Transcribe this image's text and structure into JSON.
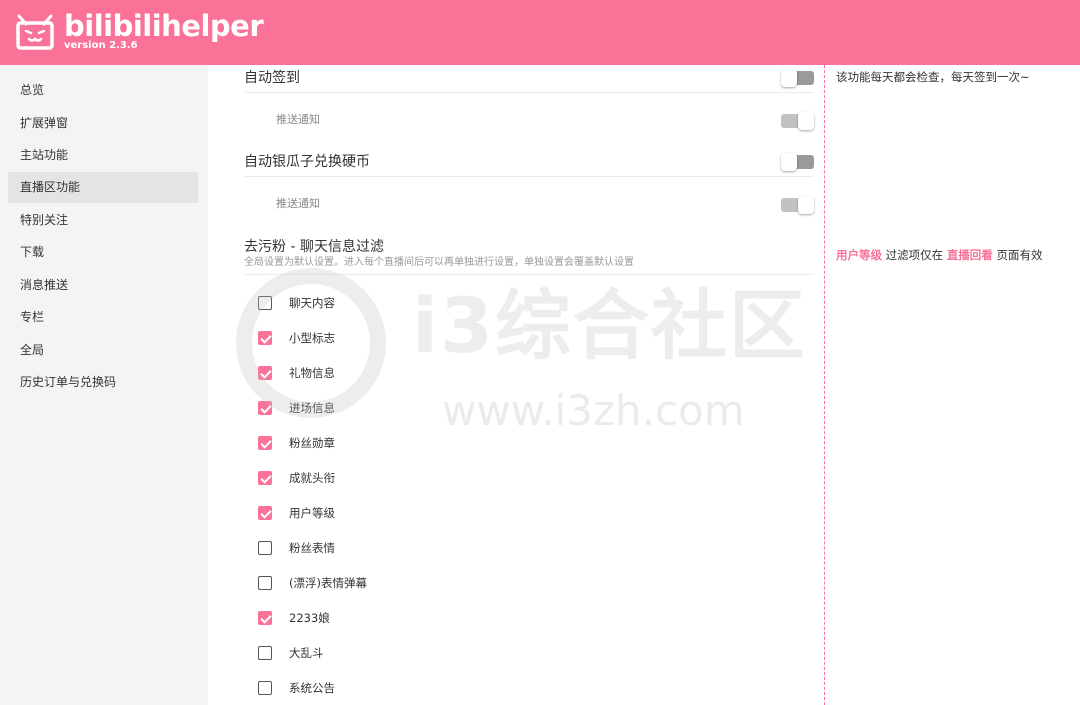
{
  "header": {
    "brand": "bilibilihelper",
    "version": "version 2.3.6",
    "logo_icon": "bilibili-tv-face-icon",
    "bg_color": "#fb7299"
  },
  "sidebar": {
    "items": [
      {
        "label": "总览"
      },
      {
        "label": "扩展弹窗"
      },
      {
        "label": "主站功能"
      },
      {
        "label": "直播区功能",
        "active": true
      },
      {
        "label": "特别关注"
      },
      {
        "label": "下载"
      },
      {
        "label": "消息推送"
      },
      {
        "label": "专栏"
      },
      {
        "label": "全局"
      },
      {
        "label": "历史订单与兑换码"
      }
    ]
  },
  "settings": {
    "auto_sign": {
      "title": "自动签到",
      "enabled": false,
      "push_label": "推送通知",
      "push_enabled": false,
      "desc": "该功能每天都会检查，每天签到一次~"
    },
    "silver_to_coin": {
      "title": "自动银瓜子兑换硬币",
      "enabled": false,
      "push_label": "推送通知",
      "push_enabled": false
    },
    "chat_filter": {
      "title": "去污粉 - 聊天信息过滤",
      "subtitle": "全局设置为默认设置。进入每个直播间后可以再单独进行设置，单独设置会覆盖默认设置",
      "desc_highlight_1": "用户等级",
      "desc_text_1": " 过滤项仅在 ",
      "desc_highlight_2": "直播回看",
      "desc_text_2": " 页面有效",
      "options": [
        {
          "label": "聊天内容",
          "checked": false
        },
        {
          "label": "小型标志",
          "checked": true
        },
        {
          "label": "礼物信息",
          "checked": true
        },
        {
          "label": "进场信息",
          "checked": true
        },
        {
          "label": "粉丝勋章",
          "checked": true
        },
        {
          "label": "成就头衔",
          "checked": true
        },
        {
          "label": "用户等级",
          "checked": true
        },
        {
          "label": "粉丝表情",
          "checked": false
        },
        {
          "label": "(漂浮)表情弹幕",
          "checked": false
        },
        {
          "label": "2233娘",
          "checked": true
        },
        {
          "label": "大乱斗",
          "checked": false
        },
        {
          "label": "系统公告",
          "checked": false
        }
      ]
    }
  },
  "watermark": {
    "text": "i3综合社区",
    "url": "www.i3zh.com"
  },
  "colors": {
    "accent": "#fb7299",
    "sidebar_bg": "#f4f4f4",
    "sidebar_active": "#e4e4e4"
  }
}
